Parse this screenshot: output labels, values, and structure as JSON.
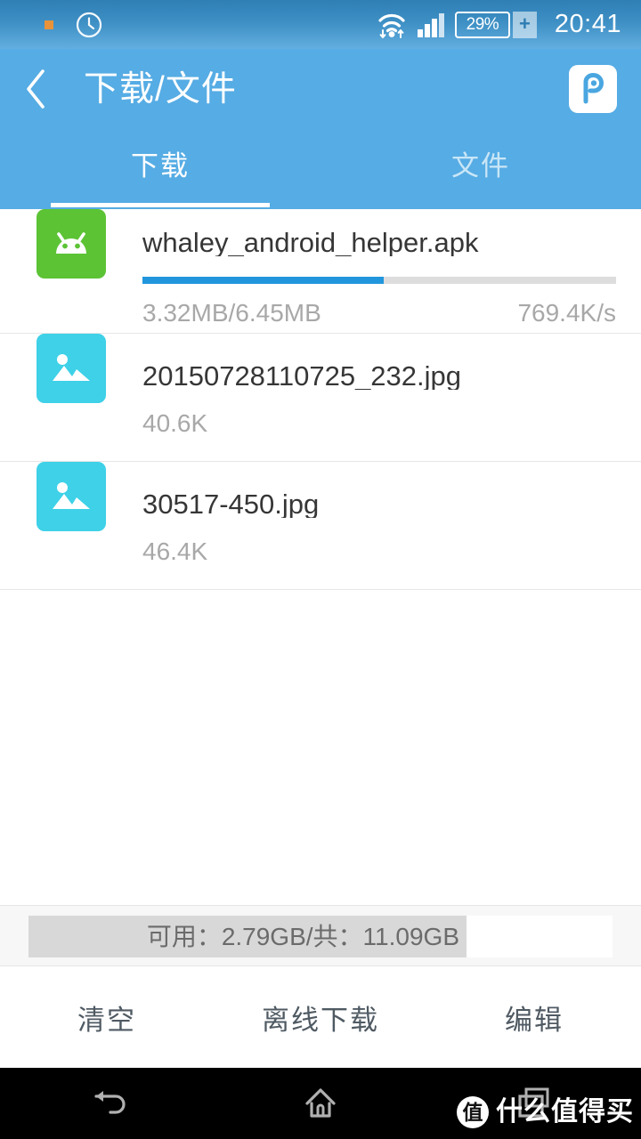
{
  "status_bar": {
    "notification_dot": "orange-square-dot",
    "alarm_icon": "clock-icon",
    "wifi_icon": "wifi-transfer-icon",
    "signal_icon": "cellular-signal-icon",
    "battery_percent": "29%",
    "charging_symbol": "+",
    "time": "20:41",
    "colors": {
      "gradient_top": "#2f7fb5",
      "gradient_bottom": "#63aee0"
    }
  },
  "header": {
    "back_icon": "chevron-left-icon",
    "title": "下载/文件",
    "logo_icon": "p-logo-icon",
    "logo_letter": "P",
    "background": "#56ace4",
    "tabs": [
      {
        "label": "下载",
        "active": true
      },
      {
        "label": "文件",
        "active": false
      }
    ]
  },
  "files": [
    {
      "name": "whaley_android_helper.apk",
      "icon": "android-robot-icon",
      "icon_color": "#5cc335",
      "type": "apk",
      "has_progress": true,
      "progress_percent": 51,
      "progress_color": "#2196dd",
      "downloaded": "3.32MB/6.45MB",
      "speed": "769.4K/s"
    },
    {
      "name": "20150728110725_232.jpg",
      "icon": "image-picture-icon",
      "icon_color": "#3ed1e8",
      "type": "image",
      "has_progress": false,
      "size": "40.6K"
    },
    {
      "name": "30517-450.jpg",
      "icon": "image-picture-icon",
      "icon_color": "#3ed1e8",
      "type": "image",
      "has_progress": false,
      "size": "46.4K"
    }
  ],
  "storage": {
    "text": "可用：2.79GB/共：11.09GB",
    "available": "2.79GB",
    "total": "11.09GB",
    "used_percent": 75,
    "fill_color": "#d8d8d8"
  },
  "actions": [
    {
      "label": "清空"
    },
    {
      "label": "离线下载"
    },
    {
      "label": "编辑"
    }
  ],
  "nav_bar": {
    "back_icon": "nav-back-icon",
    "home_icon": "nav-home-icon",
    "recents_icon": "nav-recents-icon",
    "watermark_badge": "值",
    "watermark_text": "什么值得买"
  }
}
